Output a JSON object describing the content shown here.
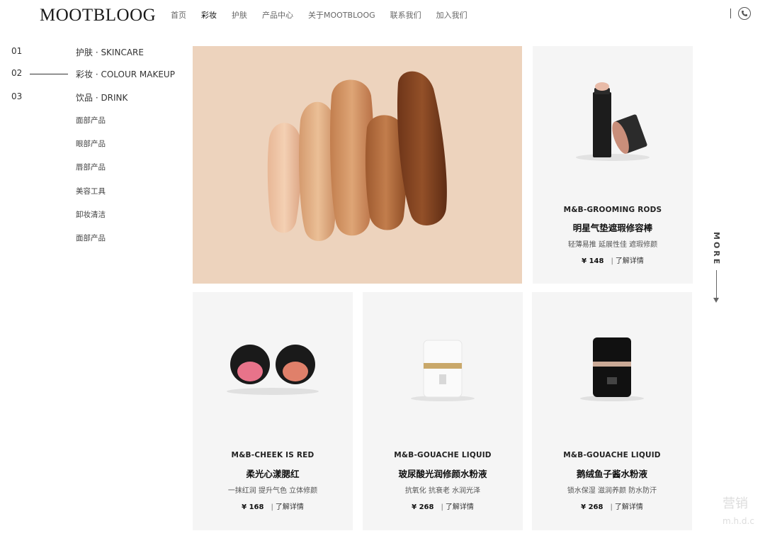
{
  "header": {
    "logo": "MOOTBLOOG",
    "nav": [
      "首页",
      "彩妆",
      "护肤",
      "产品中心",
      "关于MOOTBLOOG",
      "联系我们",
      "加入我们"
    ],
    "active_nav": "彩妆"
  },
  "sidebar": {
    "categories": [
      {
        "num": "01",
        "label": "护肤 · SKINCARE"
      },
      {
        "num": "02",
        "label": "彩妆 · COLOUR MAKEUP"
      },
      {
        "num": "03",
        "label": "饮品 · DRINK"
      }
    ],
    "subitems": [
      "面部产品",
      "眼部产品",
      "唇部产品",
      "美容工具",
      "卸妆清洁",
      "面部产品"
    ]
  },
  "products": [
    {
      "en": "M&B-GROOMING RODS",
      "cn": "明星气垫遮瑕修容棒",
      "tags": "轻薄易推 延展性佳 遮瑕修颜",
      "price": "¥ 148",
      "link": "了解详情"
    },
    {
      "en": "M&B-CHEEK IS RED",
      "cn": "柔光心漾腮红",
      "tags": "一抹红润  提升气色  立体修颜",
      "price": "¥ 168",
      "link": "了解详情"
    },
    {
      "en": "M&B-GOUACHE LIQUID",
      "cn": "玻尿酸光润修颜水粉液",
      "tags": "抗氧化 抗衰老  水润光泽",
      "price": "¥ 268",
      "link": "了解详情"
    },
    {
      "en": "M&B-GOUACHE LIQUID",
      "cn": "鹅绒鱼子酱水粉液",
      "tags": "锁水保湿 滋润养颜 防水防汗",
      "price": "¥ 268",
      "link": "了解详情"
    }
  ],
  "more_label": "MORE",
  "watermark": {
    "line1": "营销",
    "line2": "m.h.d.c"
  },
  "icons": {
    "phone": "phone-icon",
    "arrow": "arrow-down-icon"
  },
  "colors": {
    "banner_bg": "#edd3bd",
    "card_bg": "#f5f5f5"
  }
}
